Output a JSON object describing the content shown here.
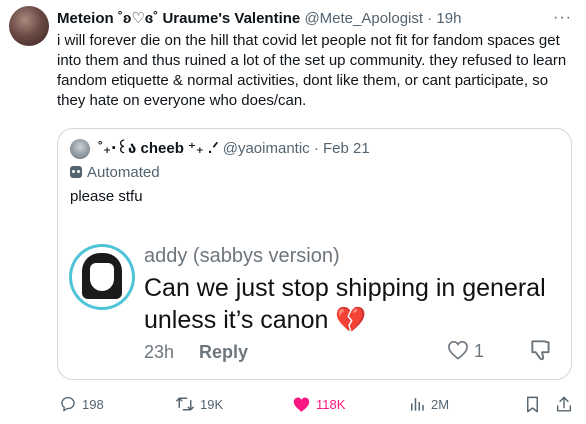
{
  "tweet": {
    "display_name": "Meteion ˚ʚ♡ɞ˚ Uraume's Valentine",
    "handle": "@Mete_Apologist",
    "separator": "·",
    "time": "19h",
    "more_label": "···",
    "text": "i will forever die on the hill that covid let people not fit for fandom spaces get into them and thus ruined a lot of the set up community. they refused to learn fandom etiquette & normal activities, dont like them, or cant participate, so they hate on everyone who does/can."
  },
  "quote": {
    "display_name": "˚₊‧꒰ა cheeb ⁺₊ .ᐟ",
    "handle": "@yaoimantic",
    "separator": "·",
    "date": "Feb 21",
    "automated_label": "Automated",
    "text": "please stfu",
    "embedded_reply": {
      "name": "addy (sabbys version)",
      "text": "Can we just stop shipping in general unless it’s canon 💔",
      "time": "23h",
      "reply_label": "Reply",
      "like_count": "1",
      "avatar_ring_color": "#4fc3d8"
    }
  },
  "actions": {
    "replies": "198",
    "reposts": "19K",
    "likes": "118K",
    "views": "2M",
    "like_color": "#f91880",
    "muted_color": "#536471"
  }
}
